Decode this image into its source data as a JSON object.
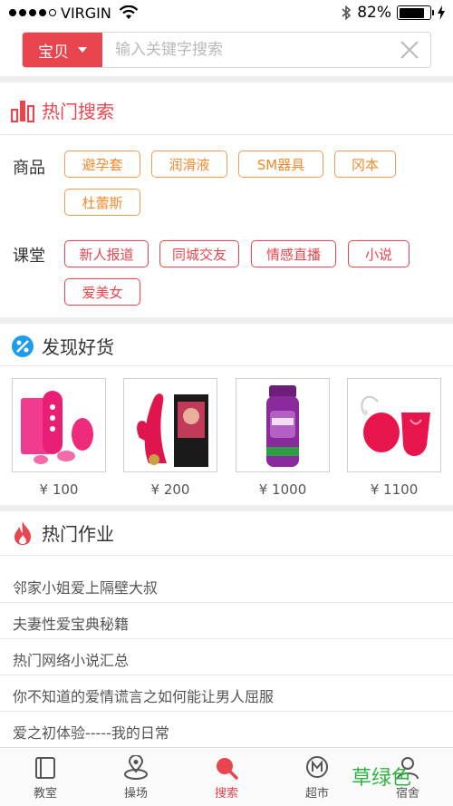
{
  "status": {
    "carrier": "VIRGIN",
    "battery": "82%",
    "battery_level": 0.82
  },
  "search": {
    "scope_label": "宝贝",
    "placeholder": "输入关键字搜索"
  },
  "hot_search": {
    "title": "热门搜索",
    "groups": [
      {
        "label": "商品",
        "tags": [
          "避孕套",
          "润滑液",
          "SM器具",
          "冈本",
          "杜蕾斯"
        ]
      },
      {
        "label": "课堂",
        "tags": [
          "新人报道",
          "同城交友",
          "情感直播",
          "小说",
          "爱美女"
        ]
      }
    ]
  },
  "discover": {
    "title": "发现好货",
    "products": [
      {
        "price": "¥ 100"
      },
      {
        "price": "¥ 200"
      },
      {
        "price": "¥ 1000"
      },
      {
        "price": "¥ 1100"
      }
    ]
  },
  "homework": {
    "title": "热门作业",
    "items": [
      "邻家小姐爱上隔壁大叔",
      "夫妻性爱宝典秘籍",
      "热门网络小说汇总",
      "你不知道的爱情谎言之如何能让男人屈服",
      "爱之初体验-----我的日常"
    ]
  },
  "tabbar": {
    "tabs": [
      {
        "label": "教室",
        "icon": "book-icon"
      },
      {
        "label": "操场",
        "icon": "location-icon"
      },
      {
        "label": "搜索",
        "icon": "search-icon"
      },
      {
        "label": "超市",
        "icon": "market-icon"
      },
      {
        "label": "宿舍",
        "icon": "user-icon"
      }
    ],
    "active_index": 2
  },
  "watermark": "草绿色",
  "colors": {
    "accent": "#e8454f",
    "tag_orange": "#f08a2e",
    "watermark": "#2fb344"
  }
}
